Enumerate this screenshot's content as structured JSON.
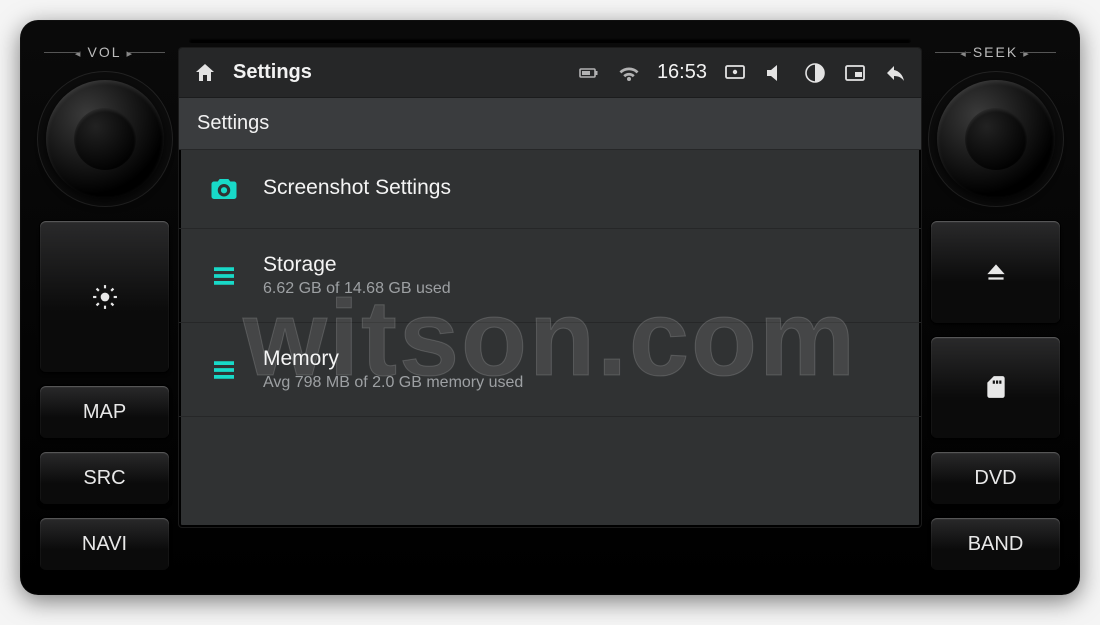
{
  "hardware": {
    "left_knob_label": "VOL",
    "right_knob_label": "SEEK",
    "left_buttons": [
      "MAP",
      "SRC",
      "NAVI"
    ],
    "right_buttons": [
      "DVD",
      "BAND"
    ]
  },
  "statusbar": {
    "title": "Settings",
    "time": "16:53"
  },
  "page": {
    "header": "Settings",
    "rows": [
      {
        "type": "screenshot",
        "title": "Screenshot Settings",
        "sub": ""
      },
      {
        "type": "storage",
        "title": "Storage",
        "sub": "6.62 GB of 14.68 GB used"
      },
      {
        "type": "memory",
        "title": "Memory",
        "sub": "Avg 798 MB of 2.0 GB memory used"
      }
    ]
  },
  "watermark": "witson.com"
}
